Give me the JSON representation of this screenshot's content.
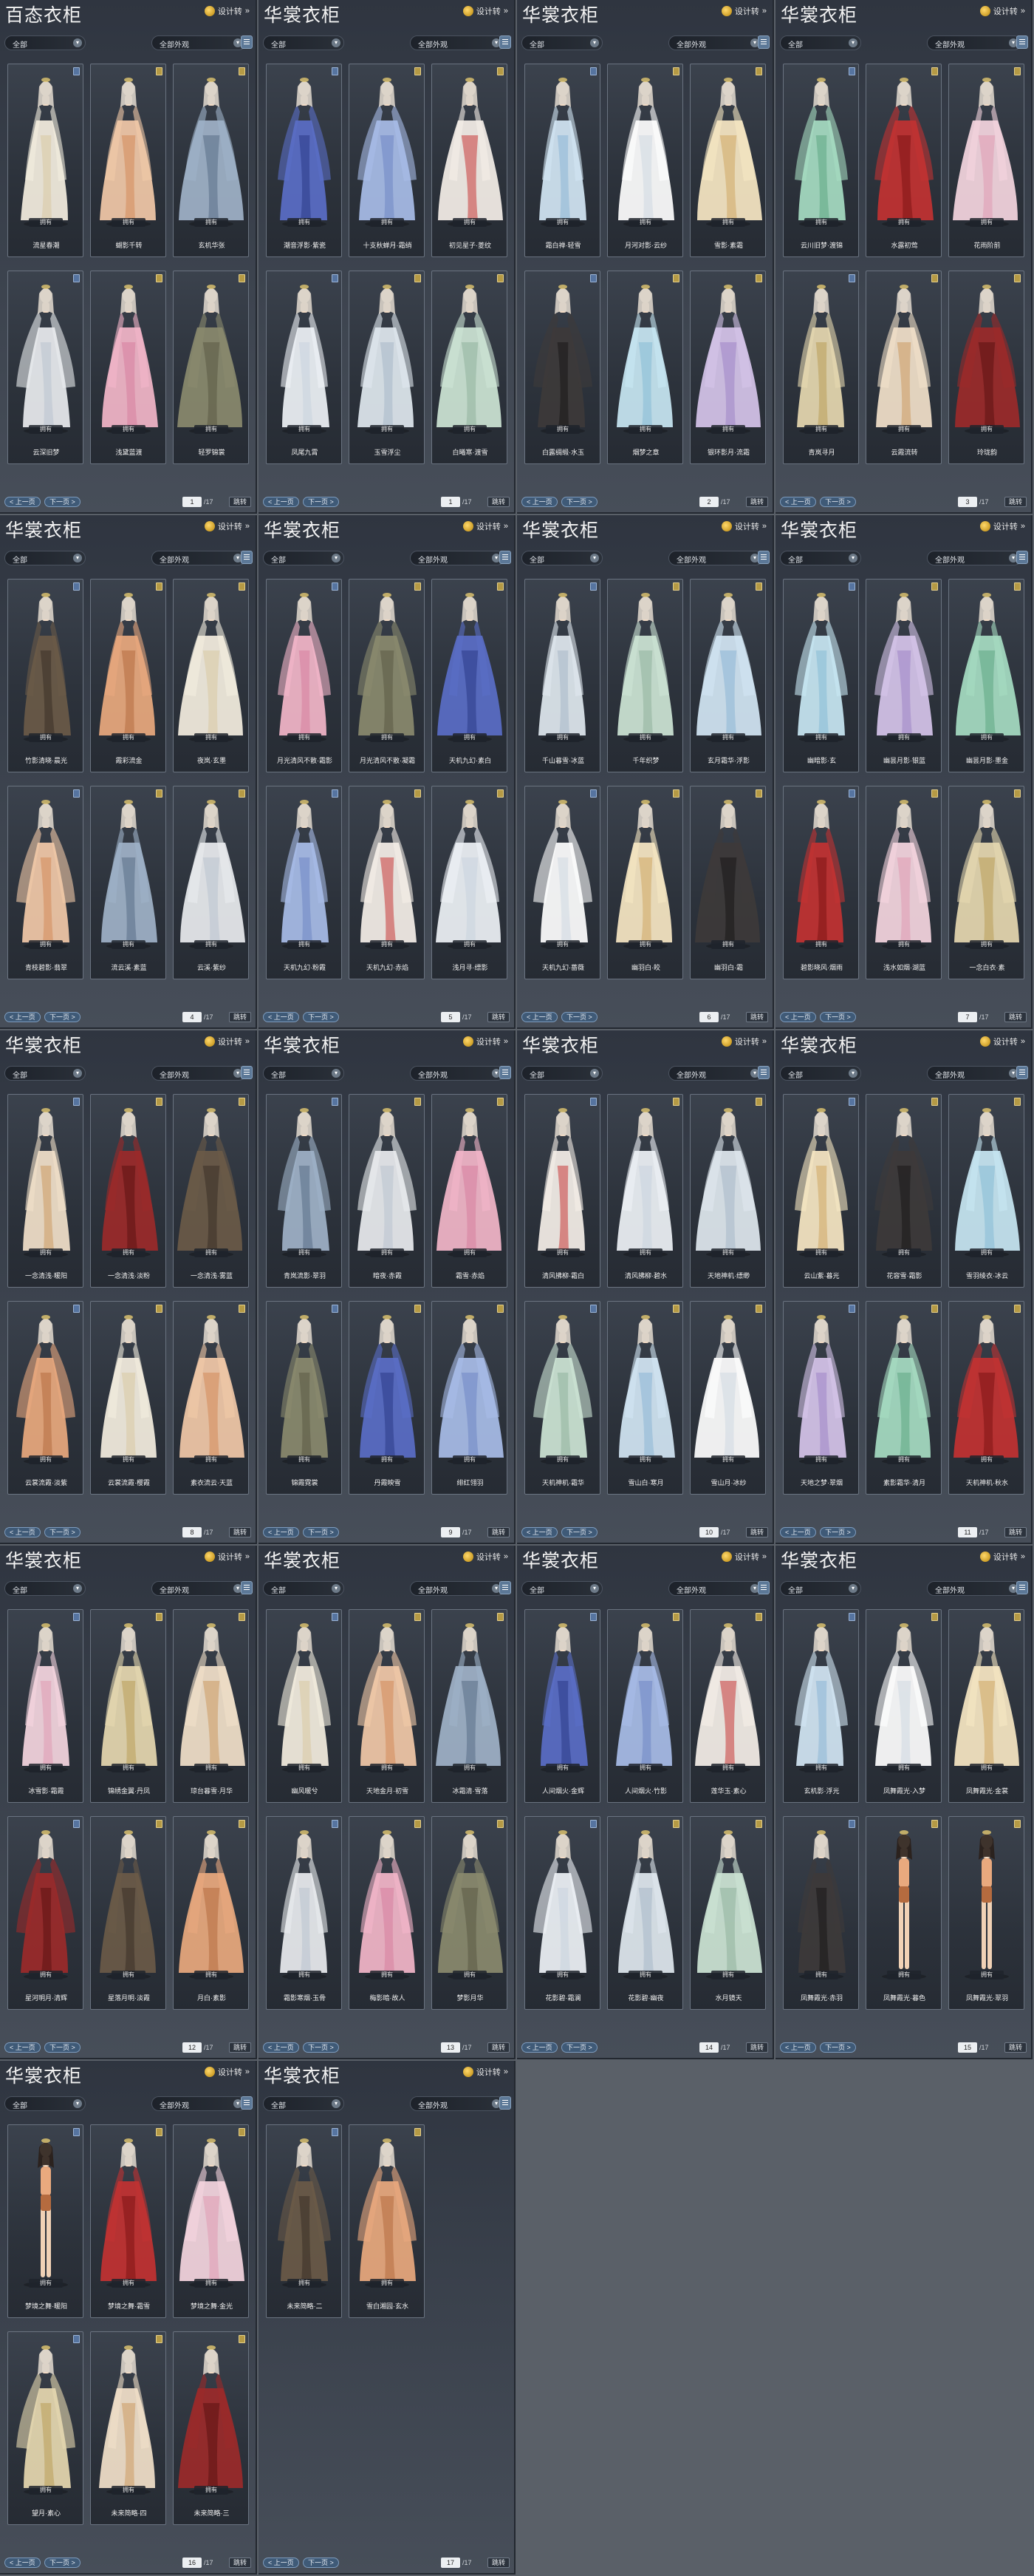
{
  "labels": {
    "designer": "设计转",
    "owned": "拥有",
    "prev": "< 上一页",
    "next": "下一页 >",
    "jump": "跳转"
  },
  "colors": {
    "panel_top": "#2f3540",
    "panel_bottom": "#474e59",
    "page_background": "#5a6068",
    "button_blue": "#3f5a77"
  },
  "panels": [
    {
      "title": "百态衣柜",
      "filter": "全部",
      "filter2": "全部外观",
      "page": "1",
      "total": "/17",
      "items": [
        "流星春潮",
        "蝴影千转",
        "玄机华张",
        "云深旧梦",
        "浅黛蓝渡",
        "轻罗锦裳"
      ]
    },
    {
      "title": "华裳衣柜",
      "filter": "全部",
      "filter2": "全部外观",
      "page": "1",
      "total": "/17",
      "items": [
        "潮音浮影·紫瓷",
        "十支秋蝉月·霜绡",
        "初见星子·菱纹",
        "凤尾九霄",
        "玉雪浮尘",
        "白曦寒·渡雪"
      ]
    },
    {
      "title": "华裳衣柜",
      "filter": "全部",
      "filter2": "全部外观",
      "page": "2",
      "total": "/17",
      "items": [
        "霜白禅·轻雪",
        "月河对影·云纱",
        "雪影·素霜",
        "白露绸缎·水玉",
        "烟梦之章",
        "银环影月·流霜"
      ]
    },
    {
      "title": "华裳衣柜",
      "filter": "全部",
      "filter2": "全部外观",
      "page": "3",
      "total": "/17",
      "items": [
        "云川旧梦·渡锦",
        "水露初莺",
        "花雨阶前",
        "青岚寻月",
        "云霞流转",
        "玲珑韵"
      ]
    },
    {
      "title": "华裳衣柜",
      "filter": "全部",
      "filter2": "全部外观",
      "page": "4",
      "total": "/17",
      "items": [
        "竹影清晓·晨光",
        "霞彩流金",
        "夜岚·玄墨",
        "青枝碧影·翡翠",
        "流云溪·素蓝",
        "云溪·紫纱"
      ]
    },
    {
      "title": "华裳衣柜",
      "filter": "全部",
      "filter2": "全部外观",
      "page": "5",
      "total": "/17",
      "items": [
        "月光清风不散·霜影",
        "月光清风不散·凝霜",
        "天机九幻·素白",
        "天机九幻·粉霞",
        "天机九幻·赤焰",
        "浅月寻·缥影"
      ]
    },
    {
      "title": "华裳衣柜",
      "filter": "全部",
      "filter2": "全部外观",
      "page": "6",
      "total": "/17",
      "items": [
        "千山暮雪·冰蓝",
        "千年织梦",
        "玄月霜华·浮影",
        "天机九幻·蔷薇",
        "幽羽白·皎",
        "幽羽白·霜"
      ]
    },
    {
      "title": "华裳衣柜",
      "filter": "全部",
      "filter2": "全部外观",
      "page": "7",
      "total": "/17",
      "items": [
        "幽暗影·玄",
        "幽昙月影·银蓝",
        "幽昙月影·墨金",
        "碧影晓风·烟雨",
        "浅水如烟·湖蓝",
        "一念白衣·素"
      ]
    },
    {
      "title": "华裳衣柜",
      "filter": "全部",
      "filter2": "全部外观",
      "page": "8",
      "total": "/17",
      "items": [
        "一念清浅·暖阳",
        "一念清浅·淡粉",
        "一念清浅·雾蓝",
        "云裳流霞·淡紫",
        "云裳流霞·樱霞",
        "素衣流云·天蓝"
      ]
    },
    {
      "title": "华裳衣柜",
      "filter": "全部",
      "filter2": "全部外观",
      "page": "9",
      "total": "/17",
      "items": [
        "青岚流影·翠羽",
        "暗夜·赤霞",
        "霜雪·赤焰",
        "锦霞霓裳",
        "丹霞映雪",
        "绯红翎羽"
      ]
    },
    {
      "title": "华裳衣柜",
      "filter": "全部",
      "filter2": "全部外观",
      "page": "10",
      "total": "/17",
      "items": [
        "清风拂柳·霜白",
        "清风拂柳·碧水",
        "天地神机·缥缈",
        "天机神机·霜华",
        "雪山白·寒月",
        "雪山月·冰纱"
      ]
    },
    {
      "title": "华裳衣柜",
      "filter": "全部",
      "filter2": "全部外观",
      "page": "11",
      "total": "/17",
      "items": [
        "云山紫·暮光",
        "花容雪·霜影",
        "雪羽绫衣·冰云",
        "天地之梦·翠烟",
        "素影霜华·清月",
        "天机神机·秋水"
      ]
    },
    {
      "title": "华裳衣柜",
      "filter": "全部",
      "filter2": "全部外观",
      "page": "12",
      "total": "/17",
      "items": [
        "冰雪影·霜霞",
        "锦绣金翼·丹凤",
        "琼台暮雪·月华",
        "星河明月·清辉",
        "星落月明·淡霞",
        "月白·素影"
      ]
    },
    {
      "title": "华裳衣柜",
      "filter": "全部",
      "filter2": "全部外观",
      "page": "13",
      "total": "/17",
      "items": [
        "幽风暖兮",
        "天地金月·初雪",
        "冰霜清·雪落",
        "霜影寒烟·玉骨",
        "梅影暗·故人",
        "梦影月华"
      ]
    },
    {
      "title": "华裳衣柜",
      "filter": "全部",
      "filter2": "全部外观",
      "page": "14",
      "total": "/17",
      "items": [
        "人间烟火·金辉",
        "人间烟火·竹影",
        "莲华玉·素心",
        "花影碧·霜澜",
        "花影碧·幽夜",
        "水月镜天"
      ]
    },
    {
      "title": "华裳衣柜",
      "filter": "全部",
      "filter2": "全部外观",
      "page": "15",
      "total": "/17",
      "items": [
        "玄机影·浮光",
        "凤舞霞光·入梦",
        "凤舞霞光·金裳",
        "凤舞霞光·赤羽",
        "凤舞霞光·暮色",
        "凤舞霞光·翠羽"
      ]
    },
    {
      "title": "华裳衣柜",
      "filter": "全部",
      "filter2": "全部外观",
      "page": "16",
      "total": "/17",
      "items": [
        "梦境之舞·暖阳",
        "梦境之舞·霜雪",
        "梦境之舞·金光",
        "望月·素心",
        "未来简略·四",
        "未来简略·三"
      ]
    },
    {
      "title": "华裳衣柜",
      "filter": "全部",
      "filter2": "全部外观",
      "page": "17",
      "total": "/17",
      "items": [
        "未来简略·二",
        "雪白湘园·玄水"
      ]
    }
  ]
}
